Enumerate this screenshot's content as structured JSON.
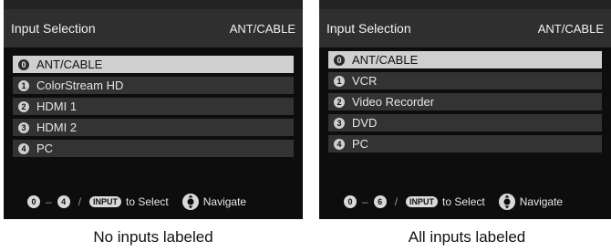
{
  "panels": [
    {
      "header": {
        "title": "Input Selection",
        "source": "ANT/CABLE"
      },
      "items": [
        {
          "num": "0",
          "label": "ANT/CABLE"
        },
        {
          "num": "1",
          "label": "ColorStream HD"
        },
        {
          "num": "2",
          "label": "HDMI 1"
        },
        {
          "num": "3",
          "label": "HDMI 2"
        },
        {
          "num": "4",
          "label": "PC"
        }
      ],
      "footer": {
        "range_start": "0",
        "range_end": "4",
        "input_key": "INPUT",
        "select_text": "to Select",
        "navigate_text": "Navigate"
      },
      "caption": "No inputs labeled"
    },
    {
      "header": {
        "title": "Input Selection",
        "source": "ANT/CABLE"
      },
      "items": [
        {
          "num": "0",
          "label": "ANT/CABLE"
        },
        {
          "num": "1",
          "label": "VCR"
        },
        {
          "num": "2",
          "label": "Video Recorder"
        },
        {
          "num": "3",
          "label": "DVD"
        },
        {
          "num": "4",
          "label": "PC"
        }
      ],
      "footer": {
        "range_start": "0",
        "range_end": "6",
        "input_key": "INPUT",
        "select_text": "to Select",
        "navigate_text": "Navigate"
      },
      "caption": "All inputs labeled"
    }
  ],
  "colors": {
    "panel_bg": "#0d0d0d",
    "header_bg": "#2f2f2f",
    "item_bg": "#333333",
    "selected_bg": "#cfcfcf"
  },
  "icons": {
    "navigate": "dpad-icon"
  }
}
